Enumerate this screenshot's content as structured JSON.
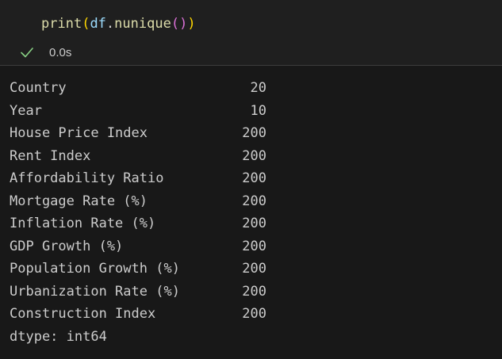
{
  "code_cell": {
    "fn": "print",
    "open1": "(",
    "obj": "df",
    "dot": ".",
    "method": "nunique",
    "open2": "(",
    "close2": ")",
    "close1": ")",
    "status_icon": "check-icon",
    "exec_time": "0.0s"
  },
  "output": {
    "rows": [
      {
        "name": "Country",
        "value": "20"
      },
      {
        "name": "Year",
        "value": "10"
      },
      {
        "name": "House Price Index",
        "value": "200"
      },
      {
        "name": "Rent Index",
        "value": "200"
      },
      {
        "name": "Affordability Ratio",
        "value": "200"
      },
      {
        "name": "Mortgage Rate (%)",
        "value": "200"
      },
      {
        "name": "Inflation Rate (%)",
        "value": "200"
      },
      {
        "name": "GDP Growth (%)",
        "value": "200"
      },
      {
        "name": "Population Growth (%)",
        "value": "200"
      },
      {
        "name": "Urbanization Rate (%)",
        "value": "200"
      },
      {
        "name": "Construction Index",
        "value": "200"
      }
    ],
    "dtype": "dtype: int64"
  },
  "colors": {
    "background": "#1f1f1f",
    "output_background": "#181818",
    "check": "#89d185",
    "function": "#dcdcaa",
    "variable": "#9cdcfe",
    "bracket_level1": "#ffd700",
    "bracket_level2": "#da70d6"
  }
}
